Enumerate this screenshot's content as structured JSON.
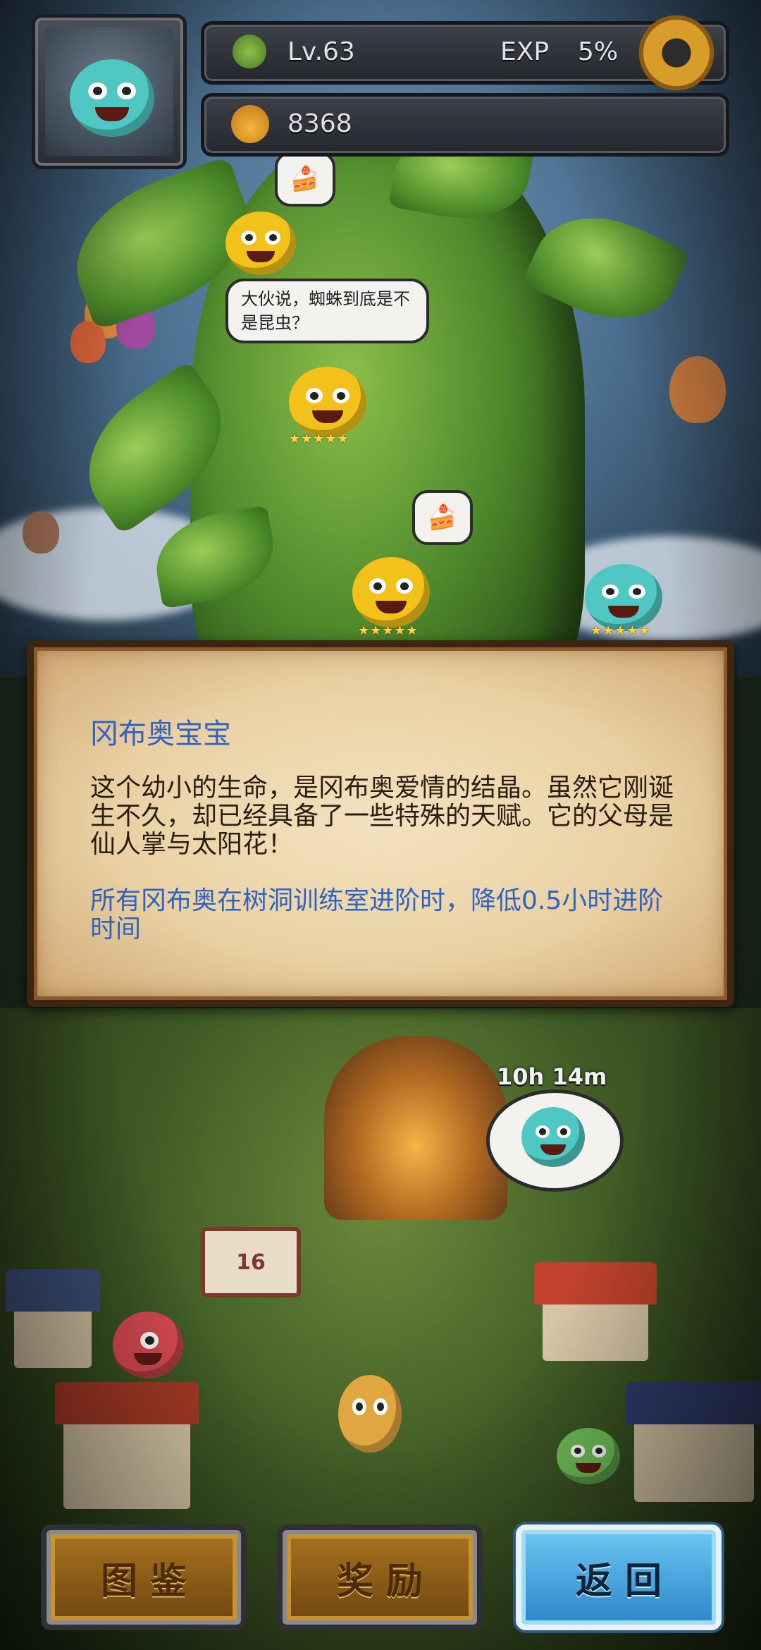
{
  "hud": {
    "level": "Lv.63",
    "exp_label": "EXP",
    "exp_value": "5%",
    "currency": "8368"
  },
  "scene": {
    "bubble_text": "大伙说，蜘蛛到底是不是昆虫？",
    "sign_number": "16",
    "timer": "10h 14m",
    "star_rating": "★★★★★"
  },
  "panel": {
    "title": "冈布奥宝宝",
    "description": "这个幼小的生命，是冈布奥爱情的结晶。虽然它刚诞生不久，却已经具备了一些特殊的天赋。它的父母是仙人掌与太阳花！",
    "effect": "所有冈布奥在树洞训练室进阶时，降低0.5小时进阶时间"
  },
  "buttons": {
    "codex": "图鉴",
    "rewards": "奖励",
    "back": "返回"
  },
  "colors": {
    "panel_title": "#2f63bf",
    "panel_text": "#2a1e12",
    "back_button": "#4aa6e0",
    "gold_button": "#8d5c18"
  }
}
